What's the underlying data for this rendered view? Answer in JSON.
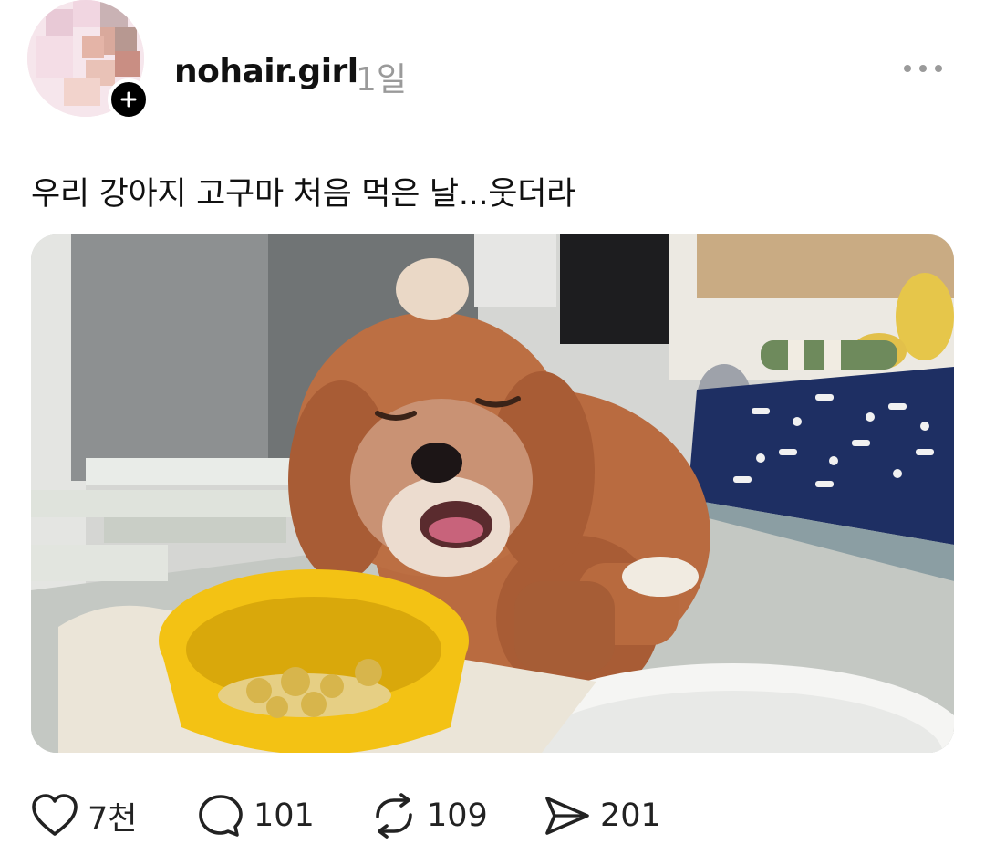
{
  "post": {
    "username": "nohair.girl",
    "timestamp": "1일",
    "caption": "우리 강아지 고구마 처음 먹은 날...웃더라",
    "image_alt": "강아지",
    "actions": {
      "likes": "7천",
      "comments": "101",
      "reposts": "109",
      "shares": "201"
    }
  },
  "icons": {
    "avatar": "avatar",
    "follow": "plus-icon",
    "more": "more-dots-icon",
    "like": "heart-icon",
    "comment": "comment-bubble-icon",
    "repost": "repost-icon",
    "share": "send-icon"
  },
  "colors": {
    "text": "#111111",
    "muted": "#9a9a9a",
    "dog_fur": "#b86a3e",
    "bowl_yellow": "#f2c012",
    "blanket_navy": "#1e2f63"
  }
}
